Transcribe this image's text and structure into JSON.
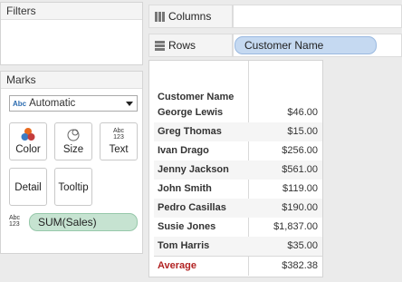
{
  "filters": {
    "title": "Filters"
  },
  "marks": {
    "title": "Marks",
    "mark_type": {
      "icon": "abc-icon",
      "selected": "Automatic"
    },
    "buttons": [
      {
        "label": "Color",
        "icon": "color-circles-icon"
      },
      {
        "label": "Size",
        "icon": "size-circles-icon"
      },
      {
        "label": "Text",
        "icon": "abc-123-icon"
      },
      {
        "label": "Detail",
        "icon": ""
      },
      {
        "label": "Tooltip",
        "icon": ""
      }
    ],
    "text_icon": {
      "line1": "Abc",
      "line2": "123"
    },
    "text_field": "SUM(Sales)"
  },
  "shelves": {
    "columns": {
      "label": "Columns"
    },
    "rows": {
      "label": "Rows",
      "pill": "Customer Name"
    }
  },
  "table": {
    "header": "Customer Name",
    "rows": [
      {
        "name": "George Lewis",
        "value": "$46.00"
      },
      {
        "name": "Greg Thomas",
        "value": "$15.00"
      },
      {
        "name": "Ivan Drago",
        "value": "$256.00"
      },
      {
        "name": "Jenny Jackson",
        "value": "$561.00"
      },
      {
        "name": "John Smith",
        "value": "$119.00"
      },
      {
        "name": "Pedro Casillas",
        "value": "$190.00"
      },
      {
        "name": "Susie Jones",
        "value": "$1,837.00"
      },
      {
        "name": "Tom Harris",
        "value": "$35.00"
      }
    ],
    "total": {
      "name": "Average",
      "value": "$382.38"
    }
  },
  "colors": {
    "rows_pill": "#c5d9f1",
    "measure_pill": "#c6e3d1",
    "average_text": "#b22222"
  }
}
